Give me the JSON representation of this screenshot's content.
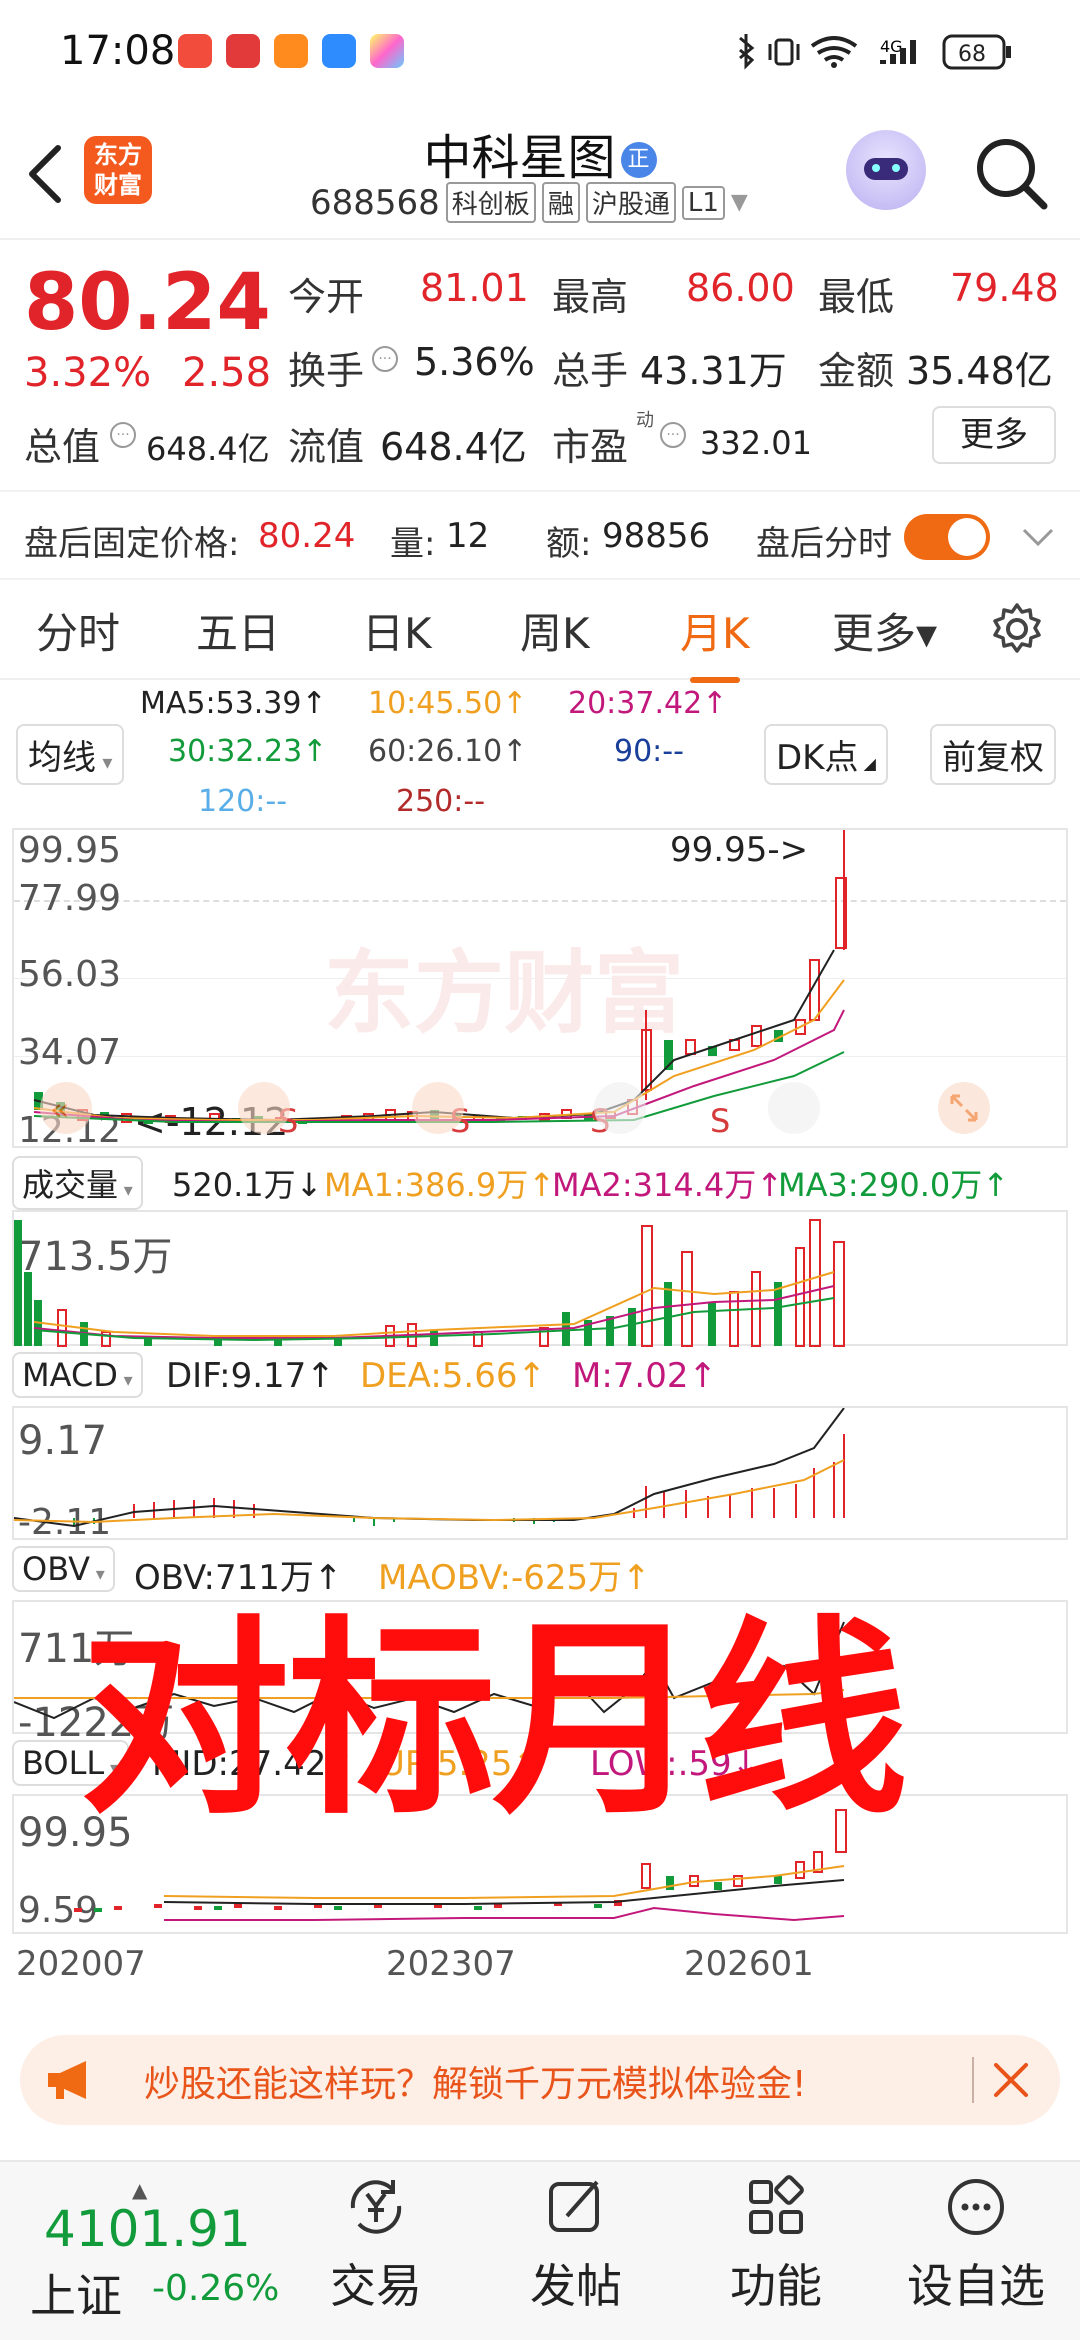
{
  "status": {
    "time": "17:08",
    "battery": "68",
    "network": "4G"
  },
  "header": {
    "logo_line1": "东方",
    "logo_line2": "财富",
    "stock_name": "中科星图",
    "name_badge": "正",
    "code": "688568",
    "tags": [
      "科创板",
      "融",
      "沪股通",
      "L1"
    ]
  },
  "quote": {
    "price": "80.24",
    "pct": "3.32%",
    "chg": "2.58",
    "open_label": "今开",
    "open": "81.01",
    "high_label": "最高",
    "high": "86.00",
    "low_label": "最低",
    "low": "79.48",
    "turnover_label": "换手",
    "turnover": "5.36%",
    "vol_label": "总手",
    "vol": "43.31万",
    "amount_label": "金额",
    "amount": "35.48亿",
    "mktcap_label": "总值",
    "mktcap": "648.4亿",
    "float_label": "流值",
    "float": "648.4亿",
    "pe_label": "市盈",
    "pe_sup": "动",
    "pe": "332.01",
    "more": "更多"
  },
  "afterhours": {
    "price_label": "盘后固定价格:",
    "price": "80.24",
    "vol_label": "量:",
    "vol": "12",
    "amt_label": "额:",
    "amt": "98856",
    "toggle_label": "盘后分时"
  },
  "tabs": [
    "分时",
    "五日",
    "日K",
    "周K",
    "月K",
    "更多▾"
  ],
  "ma": {
    "selector": "均线",
    "ma5": "MA5:53.39↑",
    "ma10": "10:45.50↑",
    "ma20": "20:37.42↑",
    "ma30": "30:32.23↑",
    "ma60": "60:26.10↑",
    "ma90": "90:--",
    "ma120": "120:--",
    "ma250": "250:--",
    "dk": "DK点",
    "adjust": "前复权"
  },
  "kline": {
    "y_labels": [
      "99.95",
      "77.99",
      "56.03",
      "34.07",
      "12.12"
    ],
    "max_mark": "99.95->",
    "min_mark": "<-12.12",
    "signals": [
      "S",
      "S",
      "S",
      "S"
    ],
    "watermark": "东方财富"
  },
  "volume": {
    "selector": "成交量",
    "value": "520.1万↓",
    "ma1": "MA1:386.9万↑",
    "ma2": "MA2:314.4万↑",
    "ma3": "MA3:290.0万↑",
    "y_label": "713.5万"
  },
  "macd": {
    "selector": "MACD",
    "dif": "DIF:9.17↑",
    "dea": "DEA:5.66↑",
    "m": "M:7.02↑",
    "y_top": "9.17",
    "y_bottom": "-2.11"
  },
  "obv": {
    "selector": "OBV",
    "value": "OBV:711万↑",
    "maobv": "MAOBV:-625万↑",
    "y_top": "711万",
    "y_bottom": "-1222万"
  },
  "boll": {
    "selector": "BOLL",
    "mid": "MID:27.42↑",
    "up": "UP:5.25↑",
    "low": "LOW:.59↓",
    "y_top": "99.95",
    "y_bottom": "9.59"
  },
  "x_axis": [
    "202007",
    "202307",
    "202601"
  ],
  "overlay_text": "对标月线",
  "banner": {
    "text": "炒股还能这样玩？解锁千万元模拟体验金!"
  },
  "nav": {
    "index_value": "4101.91",
    "index_name": "上证",
    "index_chg": "-0.26%",
    "items": [
      "交易",
      "发帖",
      "功能",
      "设自选"
    ]
  }
}
